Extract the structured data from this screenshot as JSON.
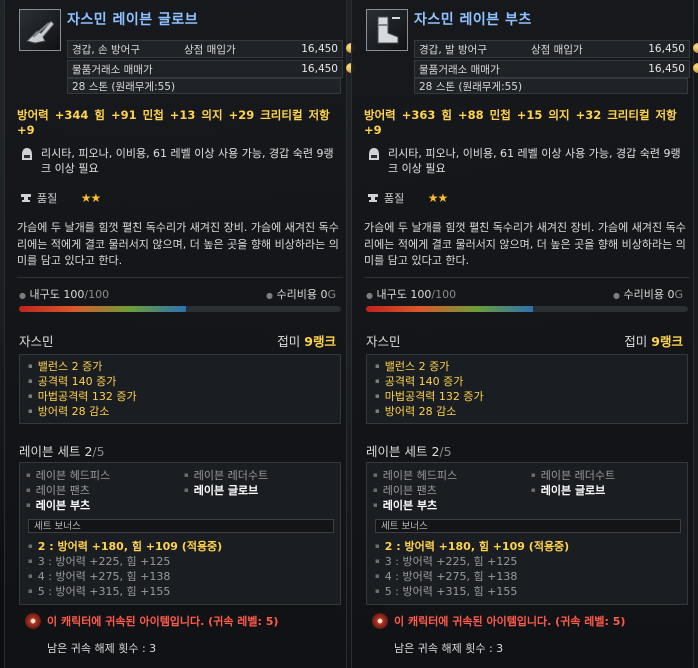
{
  "tooltips": [
    {
      "name": "자스민 레이븐 글로브",
      "type": "경갑, 손 방어구",
      "shop_label": "상점 매입가",
      "shop_price": "16,450",
      "auction_label": "물품거래소 매매가",
      "auction_price": "16,450",
      "stones": "28 스톤 (원래무게:55)",
      "stats": "방어력 +344   힘 +91   민첩 +13   의지 +29   크리티컬 저항 +9",
      "requirement": "리시타, 피오나, 이비용, 61 레벨 이상 사용 가능, 경갑 숙련 9랭크 이상 필요",
      "quality_label": "품질",
      "quality_stars": "★★",
      "description": "가슴에 두 날개를 힘껏 펼친 독수리가 새겨진 장비. 가슴에 새겨진 독수리에는 적에게 결코 물러서지 않으며, 더 높은 곳을 향해 비상하라는 의미를 담고 있다고 한다.",
      "durability_label": "내구도",
      "durability_cur": "100",
      "durability_max": "/100",
      "repair_label": "수리비용",
      "repair_value": "0",
      "repair_unit": "G",
      "enchant_title": "자스민",
      "enchant_rank_label": "접미",
      "enchant_rank": "9랭크",
      "enchant_effects": [
        "밸런스 2 증가",
        "공격력 140 증가",
        "마법공격력 132 증가",
        "방어력 28 감소"
      ],
      "set_title": "레이븐 세트",
      "set_count": "2",
      "set_total": "/5",
      "set_items": [
        {
          "label": "레이븐 헤드피스",
          "on": false
        },
        {
          "label": "레이븐 레더수트",
          "on": false
        },
        {
          "label": "레이븐 팬츠",
          "on": false
        },
        {
          "label": "레이븐 글로브",
          "on": true
        },
        {
          "label": "레이븐 부츠",
          "on": true
        }
      ],
      "set_bonus_label": "세트 보너스",
      "set_bonuses": [
        {
          "label": "2 : 방어력 +180, 힘 +109 (적용중)",
          "on": true
        },
        {
          "label": "3 : 방어력 +225, 힘 +125",
          "on": false
        },
        {
          "label": "4 : 방어력 +275, 힘 +138",
          "on": false
        },
        {
          "label": "5 : 방어력 +315, 힘 +155",
          "on": false
        }
      ],
      "bound_text": "이 캐릭터에 귀속된 아이템입니다. (귀속 레벨: 5)",
      "unbind_text": "남은 귀속 해제 횟수 : 3"
    },
    {
      "name": "자스민 레이븐 부츠",
      "type": "경갑, 발 방어구",
      "shop_label": "상점 매입가",
      "shop_price": "16,450",
      "auction_label": "물품거래소 매매가",
      "auction_price": "16,450",
      "stones": "28 스톤 (원래무게:55)",
      "stats": "방어력 +363   힘 +88   민첩 +15   의지 +32   크리티컬 저항 +9",
      "requirement": "리시타, 피오나, 이비용, 61 레벨 이상 사용 가능, 경갑 숙련 9랭크 이상 필요",
      "quality_label": "품질",
      "quality_stars": "★★",
      "description": "가슴에 두 날개를 힘껏 펼친 독수리가 새겨진 장비. 가슴에 새겨진 독수리에는 적에게 결코 물러서지 않으며, 더 높은 곳을 향해 비상하라는 의미를 담고 있다고 한다.",
      "durability_label": "내구도",
      "durability_cur": "100",
      "durability_max": "/100",
      "repair_label": "수리비용",
      "repair_value": "0",
      "repair_unit": "G",
      "enchant_title": "자스민",
      "enchant_rank_label": "접미",
      "enchant_rank": "9랭크",
      "enchant_effects": [
        "밸런스 2 증가",
        "공격력 140 증가",
        "마법공격력 132 증가",
        "방어력 28 감소"
      ],
      "set_title": "레이븐 세트",
      "set_count": "2",
      "set_total": "/5",
      "set_items": [
        {
          "label": "레이븐 헤드피스",
          "on": false
        },
        {
          "label": "레이븐 레더수트",
          "on": false
        },
        {
          "label": "레이븐 팬츠",
          "on": false
        },
        {
          "label": "레이븐 글로브",
          "on": true
        },
        {
          "label": "레이븐 부츠",
          "on": true
        }
      ],
      "set_bonus_label": "세트 보너스",
      "set_bonuses": [
        {
          "label": "2 : 방어력 +180, 힘 +109 (적용중)",
          "on": true
        },
        {
          "label": "3 : 방어력 +225, 힘 +125",
          "on": false
        },
        {
          "label": "4 : 방어력 +275, 힘 +138",
          "on": false
        },
        {
          "label": "5 : 방어력 +315, 힘 +155",
          "on": false
        }
      ],
      "bound_text": "이 캐릭터에 귀속된 아이템입니다. (귀속 레벨: 5)",
      "unbind_text": "남은 귀속 해제 횟수 : 3"
    }
  ]
}
